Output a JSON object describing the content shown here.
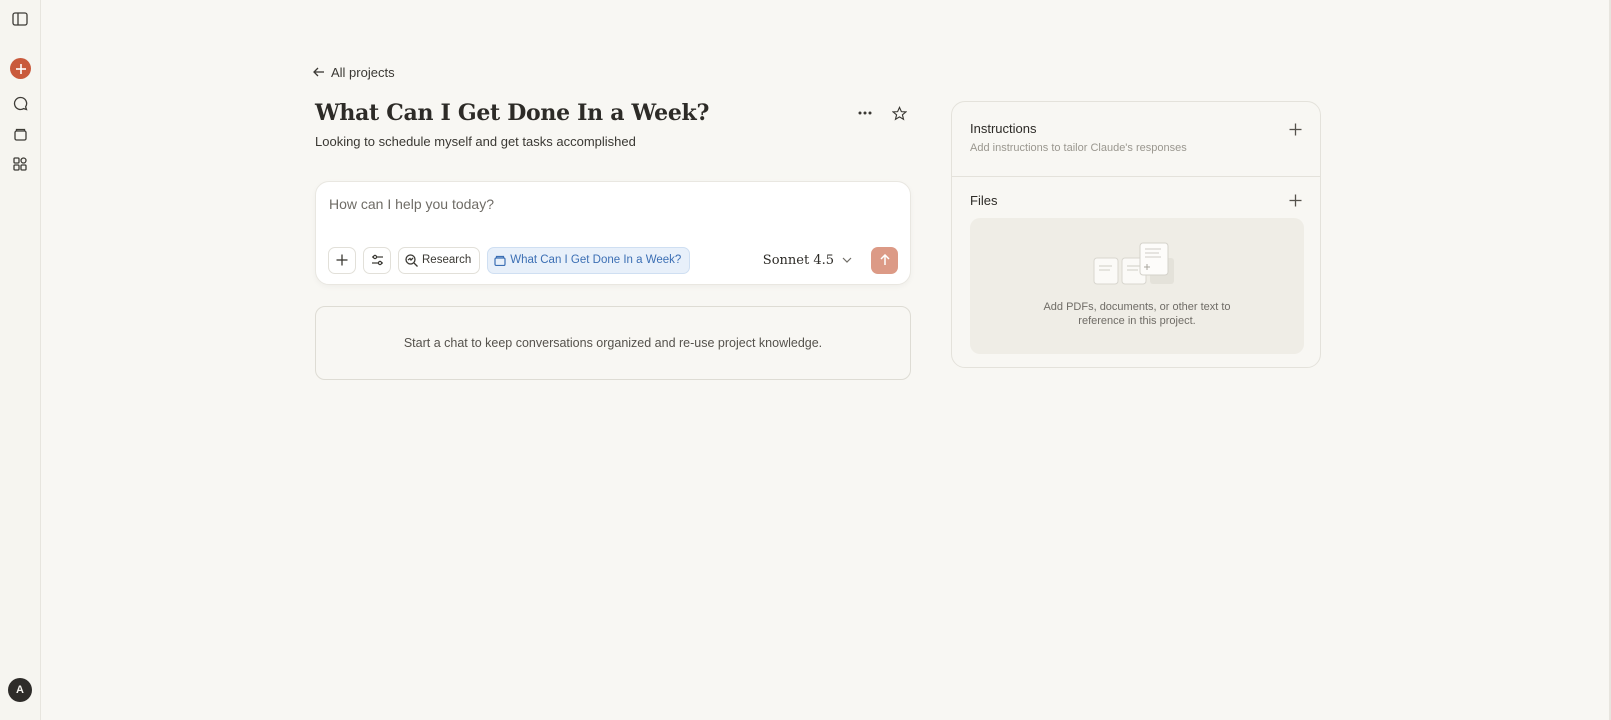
{
  "rail": {
    "items": [
      "sidebar-toggle",
      "new-chat",
      "chats",
      "projects",
      "artifacts"
    ],
    "avatar_initial": "A"
  },
  "header": {
    "back_label": "All projects",
    "title": "What Can I Get Done In a Week?",
    "subtitle": "Looking to schedule myself and get tasks accomplished"
  },
  "composer": {
    "placeholder": "How can I help you today?",
    "research_label": "Research",
    "project_chip": "What Can I Get Done In a Week?",
    "model": "Sonnet 4.5"
  },
  "empty_state": "Start a chat to keep conversations organized and re-use project knowledge.",
  "panel": {
    "instructions_title": "Instructions",
    "instructions_sub": "Add instructions to tailor Claude's responses",
    "files_title": "Files",
    "files_hint": "Add PDFs, documents, or other text to reference in this project."
  },
  "colors": {
    "background": "#f8f7f3",
    "accent": "#c95a3c",
    "send_disabled": "#dc9a86",
    "project_chip": "#3c6fb4"
  }
}
